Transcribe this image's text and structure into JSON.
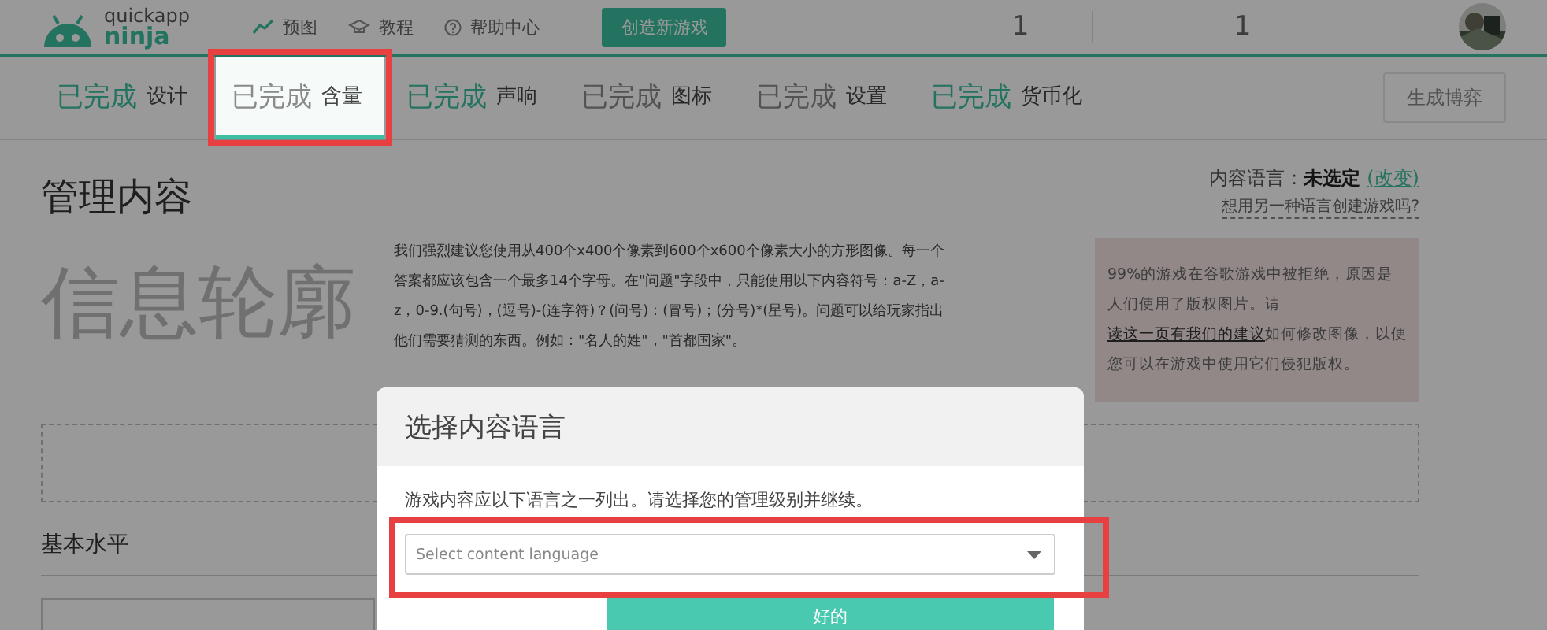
{
  "header": {
    "logo": {
      "line1": "quickapp",
      "line2": "ninja"
    },
    "nav": [
      {
        "kind": "chart",
        "label": "预图"
      },
      {
        "kind": "cap",
        "label": "教程"
      },
      {
        "kind": "help",
        "label": "帮助中心"
      }
    ],
    "create_button": "创造新游戏",
    "stats": [
      {
        "value": "1"
      },
      {
        "value": "1"
      }
    ]
  },
  "tabs": [
    {
      "status": "已完成",
      "name": "设计",
      "done": true,
      "selected": false,
      "highlighted": false
    },
    {
      "status": "已完成",
      "name": "含量",
      "done": false,
      "selected": true,
      "highlighted": true
    },
    {
      "status": "已完成",
      "name": "声响",
      "done": true,
      "selected": false,
      "highlighted": false
    },
    {
      "status": "已完成",
      "name": "图标",
      "done": false,
      "selected": false,
      "highlighted": false
    },
    {
      "status": "已完成",
      "name": "设置",
      "done": false,
      "selected": false,
      "highlighted": false
    },
    {
      "status": "已完成",
      "name": "货币化",
      "done": true,
      "selected": false,
      "highlighted": false
    }
  ],
  "generate_button": {
    "label": "生成博弈",
    "disabled": true
  },
  "page": {
    "title": "管理内容",
    "language": {
      "label": "内容语言：",
      "value": "未选定",
      "change": "(改变)",
      "hint": "想用另一种语言创建游戏吗?"
    },
    "big_heading": "信息轮廓",
    "instructions": "我们强烈建议您使用从400个x400个像素到600个x600个像素大小的方形图像。每一个答案都应该包含一个最多14个字母。在\"问题\"字段中，只能使用以下内容符号：a-Z，a-z，0-9.(句号)，(逗号)-(连字符)？(问号)：(冒号)；(分号)*(星号)。问题可以给玩家指出他们需要猜测的东西。例如：\"名人的姓\"，\"首都国家\"。",
    "notice": {
      "before": "99%的游戏在谷歌游戏中被拒绝，原因是人们使用了版权图片。请",
      "link": "读这一页有我们的建议",
      "after": "如何修改图像，以便您可以在游戏中使用它们侵犯版权。"
    },
    "section": "基本水平"
  },
  "dialog": {
    "title": "选择内容语言",
    "message": "游戏内容应以下语言之一列出。请选择您的管理级别并继续。",
    "select_placeholder": "Select content language",
    "highlighted": true,
    "ok_button": "好的"
  }
}
